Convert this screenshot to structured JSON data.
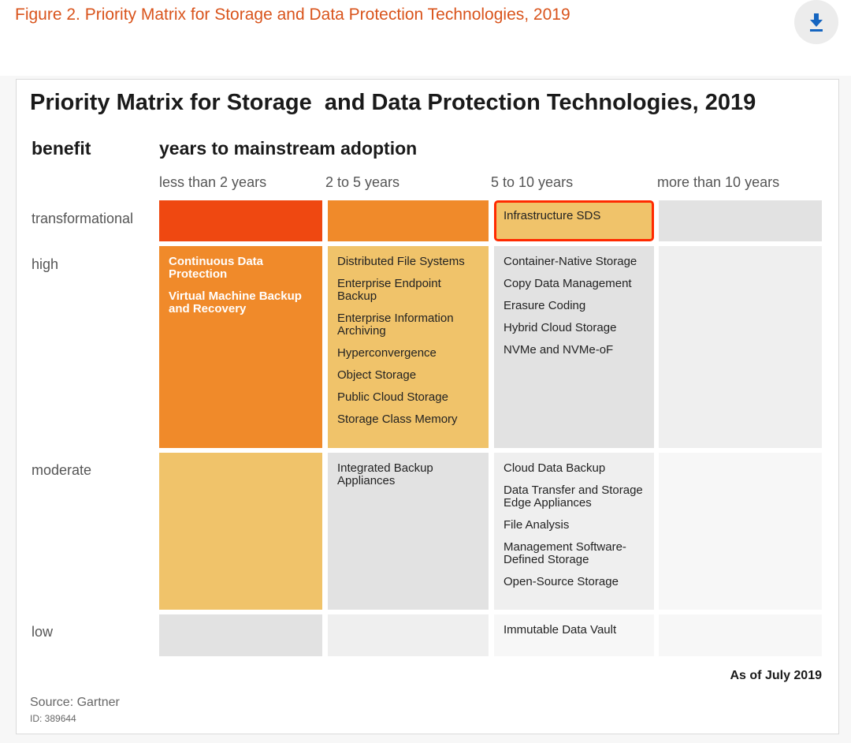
{
  "header": {
    "figure_title": "Figure 2. Priority Matrix for Storage and Data Protection Technologies, 2019",
    "download_icon": "download-icon",
    "accent_color": "#d9541c",
    "icon_color": "#1565c0"
  },
  "matrix": {
    "title": "Priority Matrix for Storage  and Data Protection Technologies, 2019",
    "y_axis_label": "benefit",
    "x_axis_label": "years to mainstream adoption",
    "columns": [
      "less than 2 years",
      "2 to 5 years",
      "5 to 10 years",
      "more than 10 years"
    ],
    "rows": [
      {
        "label": "transformational",
        "cells": [
          {
            "color": "#ef4811",
            "items": []
          },
          {
            "color": "#f08a2a",
            "items": []
          },
          {
            "color": "#f0c36a",
            "highlighted": true,
            "highlight_color": "#ff2a00",
            "items": [
              "Infrastructure SDS"
            ]
          },
          {
            "color": "#e2e2e2",
            "items": []
          }
        ]
      },
      {
        "label": "high",
        "cells": [
          {
            "color": "#f08a2a",
            "text_white": true,
            "items": [
              "Continuous Data Protection",
              "Virtual Machine Backup and Recovery"
            ]
          },
          {
            "color": "#f0c36a",
            "items": [
              "Distributed File Systems",
              "Enterprise Endpoint Backup",
              "Enterprise Information Archiving",
              "Hyperconvergence",
              "Object Storage",
              "Public Cloud Storage",
              "Storage Class Memory"
            ]
          },
          {
            "color": "#e2e2e2",
            "items": [
              "Container-Native Storage",
              "Copy Data Management",
              "Erasure Coding",
              "Hybrid Cloud Storage",
              "NVMe and NVMe-oF"
            ]
          },
          {
            "color": "#efefef",
            "items": []
          }
        ]
      },
      {
        "label": "moderate",
        "cells": [
          {
            "color": "#f0c36a",
            "items": []
          },
          {
            "color": "#e2e2e2",
            "items": [
              "Integrated Backup Appliances"
            ]
          },
          {
            "color": "#efefef",
            "items": [
              "Cloud Data Backup",
              "Data Transfer and Storage Edge Appliances",
              "File Analysis",
              "Management Software-Defined Storage",
              "Open-Source Storage"
            ]
          },
          {
            "color": "#f7f7f7",
            "items": []
          }
        ]
      },
      {
        "label": "low",
        "cells": [
          {
            "color": "#e2e2e2",
            "items": []
          },
          {
            "color": "#efefef",
            "items": []
          },
          {
            "color": "#f7f7f7",
            "items": [
              "Immutable Data Vault"
            ]
          },
          {
            "color": "#f7f7f7",
            "items": []
          }
        ]
      }
    ],
    "as_of": "As of July 2019"
  },
  "footer": {
    "source": "Source: Gartner",
    "id": "ID: 389644"
  }
}
